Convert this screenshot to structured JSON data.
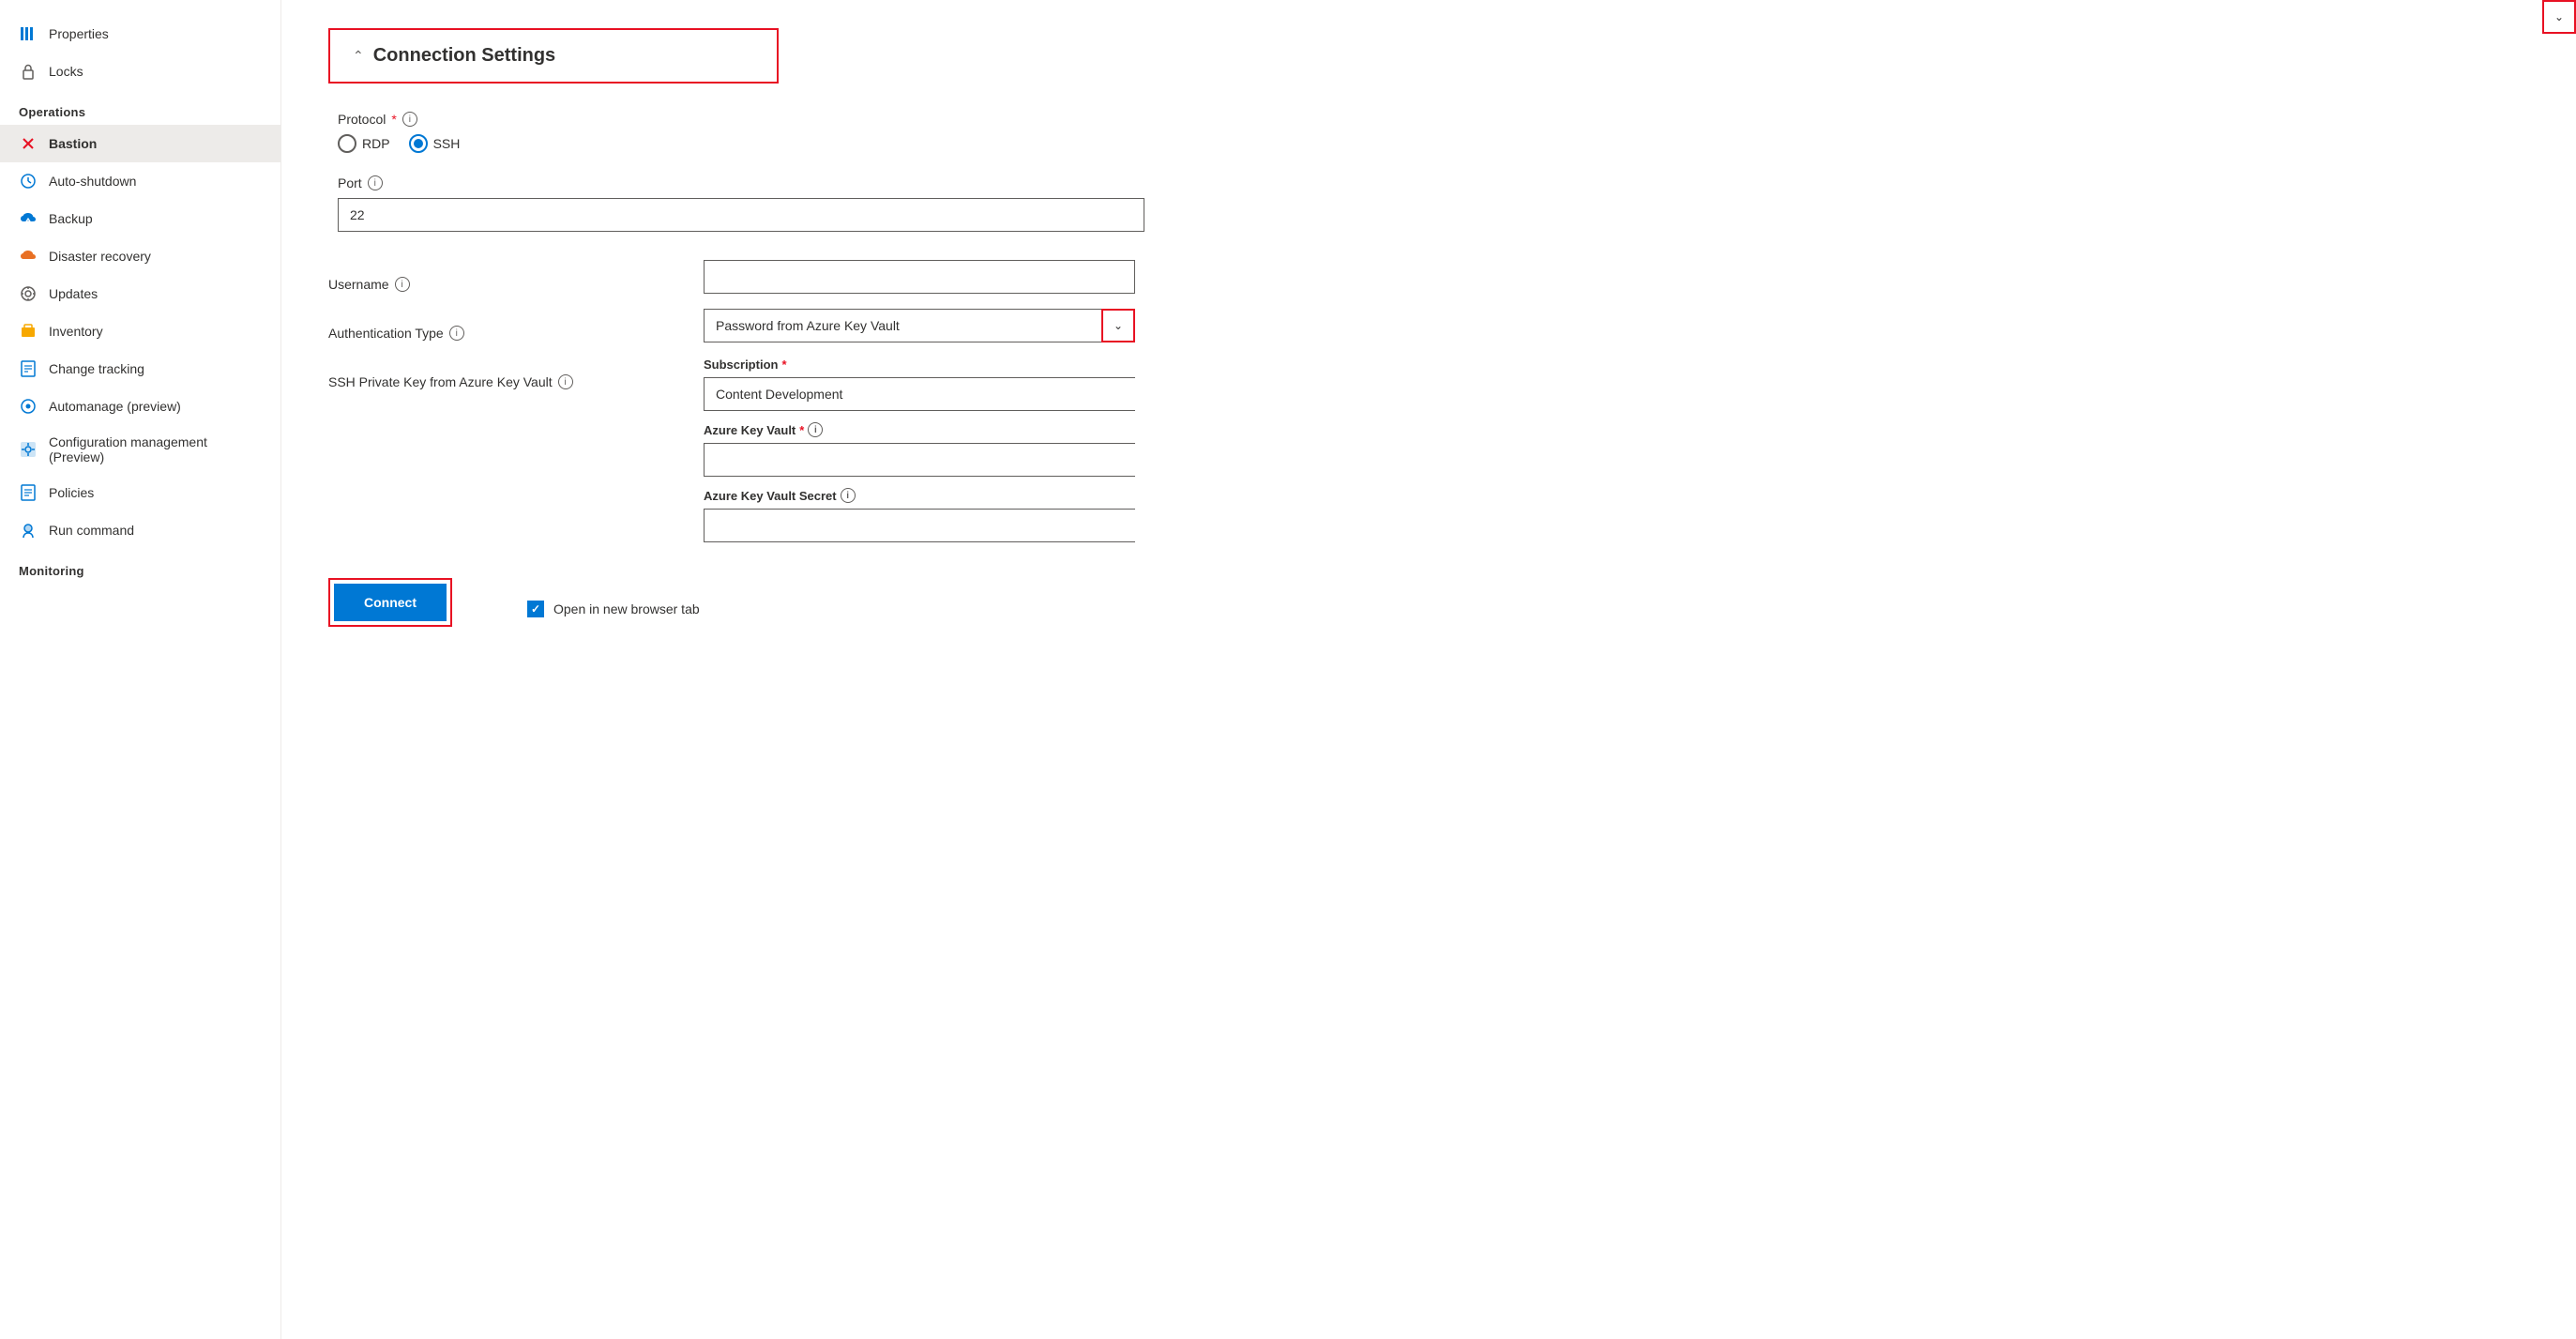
{
  "sidebar": {
    "items_top": [
      {
        "id": "properties",
        "label": "Properties",
        "icon": "≡"
      },
      {
        "id": "locks",
        "label": "Locks",
        "icon": "🔒"
      }
    ],
    "section_operations": "Operations",
    "items_operations": [
      {
        "id": "bastion",
        "label": "Bastion",
        "icon": "✕",
        "active": true
      },
      {
        "id": "auto-shutdown",
        "label": "Auto-shutdown",
        "icon": "⏰"
      },
      {
        "id": "backup",
        "label": "Backup",
        "icon": "☁"
      },
      {
        "id": "disaster-recovery",
        "label": "Disaster recovery",
        "icon": "☁"
      },
      {
        "id": "updates",
        "label": "Updates",
        "icon": "⚙"
      },
      {
        "id": "inventory",
        "label": "Inventory",
        "icon": "📦"
      },
      {
        "id": "change-tracking",
        "label": "Change tracking",
        "icon": "📋"
      },
      {
        "id": "automanage",
        "label": "Automanage (preview)",
        "icon": "⚙"
      },
      {
        "id": "config-mgmt",
        "label": "Configuration management (Preview)",
        "icon": "⚙"
      },
      {
        "id": "policies",
        "label": "Policies",
        "icon": "📋"
      },
      {
        "id": "run-command",
        "label": "Run command",
        "icon": "👤"
      }
    ],
    "section_monitoring": "Monitoring"
  },
  "main": {
    "section_title": "Connection Settings",
    "protocol_label": "Protocol",
    "protocol_required": "*",
    "protocol_options": [
      "RDP",
      "SSH"
    ],
    "protocol_selected": "SSH",
    "port_label": "Port",
    "port_value": "22",
    "username_label": "Username",
    "username_value": "",
    "username_placeholder": "",
    "auth_type_label": "Authentication Type",
    "auth_type_value": "Password from Azure Key Vault",
    "ssh_key_label": "SSH Private Key from Azure Key Vault",
    "subscription_label": "Subscription",
    "subscription_required": "*",
    "subscription_value": "Content Development",
    "azure_key_vault_label": "Azure Key Vault",
    "azure_key_vault_required": "*",
    "azure_key_vault_value": "",
    "azure_key_vault_secret_label": "Azure Key Vault Secret",
    "azure_key_vault_secret_value": "",
    "connect_label": "Connect",
    "open_new_tab_label": "Open in new browser tab",
    "open_new_tab_checked": true
  }
}
